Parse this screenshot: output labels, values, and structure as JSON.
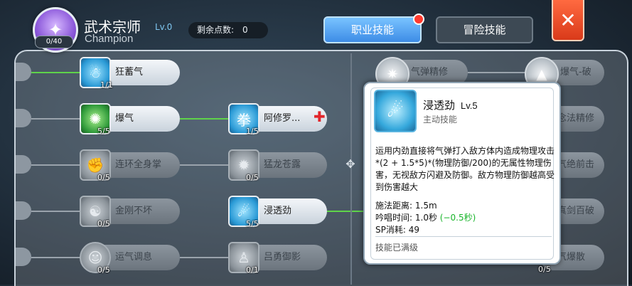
{
  "header": {
    "class_title": "武术宗师",
    "class_level": "Lv.0",
    "class_subtitle": "Champion",
    "class_points": "0/40",
    "remaining_label": "剩余点数:",
    "remaining_value": "0",
    "tab_job": "职业技能",
    "tab_adventure": "冒险技能",
    "close_glyph": "✕"
  },
  "skills": {
    "row1": {
      "name": "狂蓄气",
      "count": "1/1"
    },
    "row2": {
      "name": "爆气",
      "count": "5/5"
    },
    "row2b": {
      "name": "阿修罗...",
      "count": "1/5"
    },
    "row3": {
      "name": "连环全身掌",
      "count": "0/5"
    },
    "row3b": {
      "name": "猛龙苍露",
      "count": "0/5"
    },
    "row4": {
      "name": "金刚不坏",
      "count": "0/5"
    },
    "row4b": {
      "name": "浸透劲",
      "count": "5/5"
    },
    "row5": {
      "name": "运气调息",
      "count": "0/5"
    },
    "row5b": {
      "name": "吕勇御影",
      "count": "0/1"
    }
  },
  "right_skills": {
    "r1": {
      "name": "气弹精修"
    },
    "r1b": {
      "name": "爆气-破"
    },
    "r2": {
      "name": "念法精修"
    },
    "r3": {
      "name": "气绝前击"
    },
    "r4": {
      "name": "真剑百破"
    },
    "r5": {
      "name": "气爆散",
      "count": "0/5"
    }
  },
  "tooltip": {
    "name": "浸透劲",
    "level": "Lv.5",
    "type": "主动技能",
    "description": "运用内劲直接将气弹打入敌方体内造成物理攻击*(2 + 1.5*5)*(物理防御/200)的无属性物理伤害，无视敌方闪避及防御。敌方物理防御越高受到伤害越大",
    "range_label": "施法距离:",
    "range_value": "1.5m",
    "cast_label": "吟唱时间:",
    "cast_value": "1.0秒",
    "cast_bonus": "(−0.5秒)",
    "sp_label": "SP消耗:",
    "sp_value": "49",
    "max_text": "技能已满级"
  },
  "colors": {
    "accent_blue": "#3d8ce6",
    "close_red": "#d93a1a",
    "learned_line": "#5fd34a"
  }
}
